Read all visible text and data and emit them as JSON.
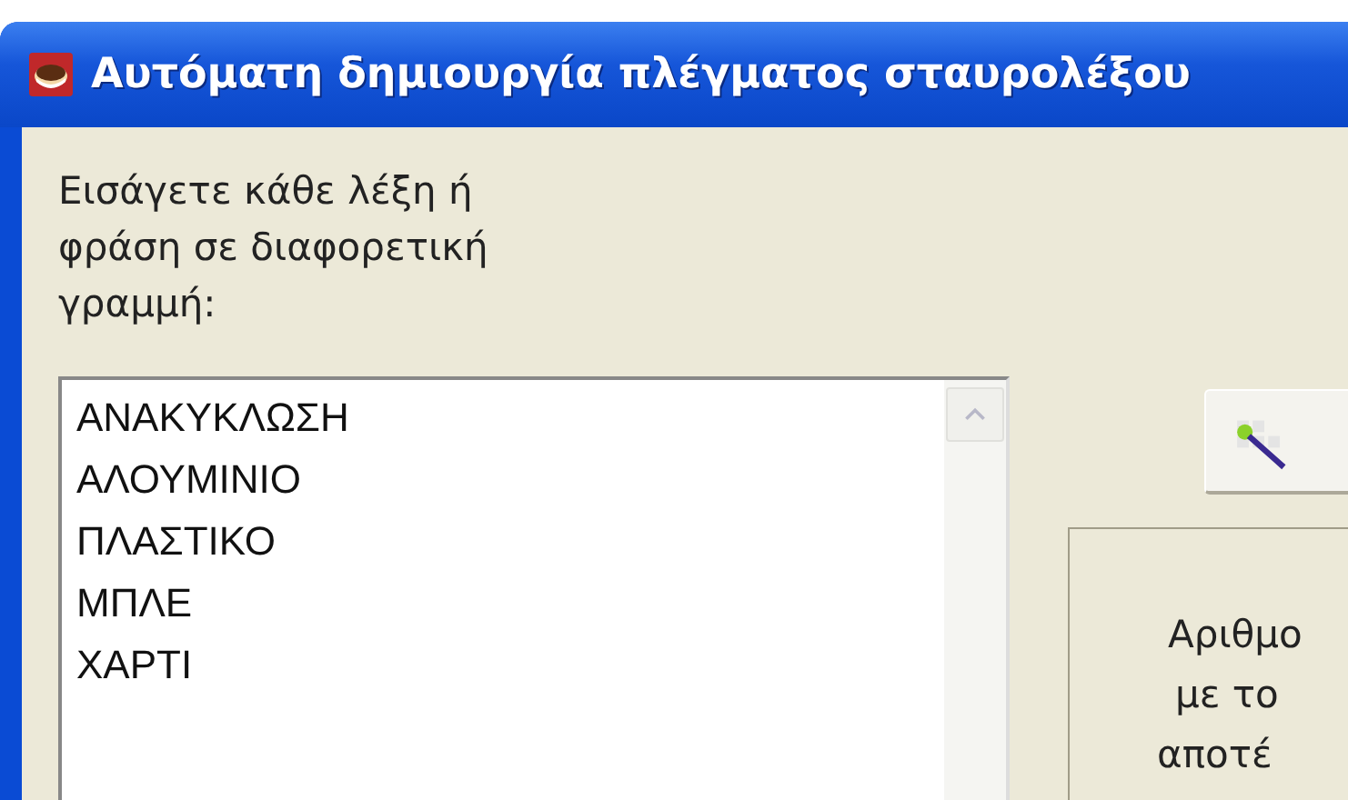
{
  "window": {
    "title": "Αυτόματη δημιουργία πλέγματος σταυρολέξου"
  },
  "instruction": "Εισάγετε κάθε λέξη ή φράση σε διαφορετική γραμμή:",
  "word_list": {
    "lines": [
      "ΑΝΑΚΥΚΛΩΣΗ",
      "ΑΛΟΥΜΙΝΙΟ",
      "ΠΛΑΣΤΙΚΟ",
      "ΜΠΛΕ",
      "ΧΑΡΤΙ"
    ]
  },
  "info_panel": {
    "lines": [
      "Αριθμο",
      "με το",
      "αποτέ"
    ]
  }
}
